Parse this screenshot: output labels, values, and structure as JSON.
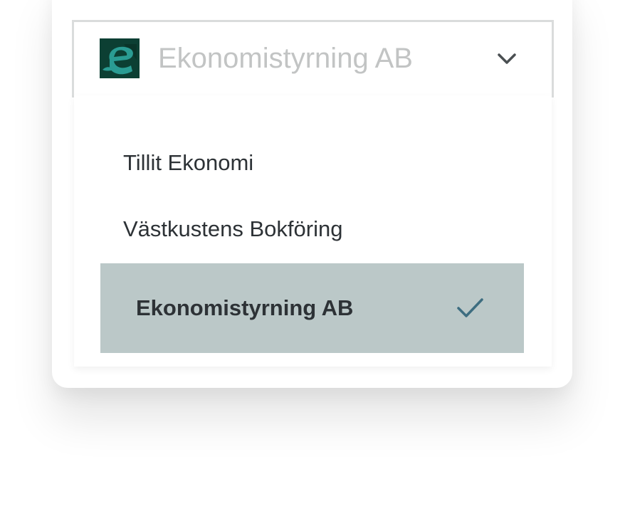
{
  "select": {
    "current_value": "Ekonomistyrning AB",
    "logo_icon": "company-logo-e",
    "chevron_icon": "chevron-down-icon"
  },
  "options": [
    {
      "label": "Tillit Ekonomi",
      "selected": false
    },
    {
      "label": "Västkustens Bokföring",
      "selected": false
    },
    {
      "label": "Ekonomistyrning AB",
      "selected": true
    }
  ],
  "colors": {
    "logo_bg": "#0c3f33",
    "logo_letter": "#2a9c93",
    "selected_bg": "#bbc8c8",
    "check": "#3d6d80",
    "placeholder_text": "#c2c4c4",
    "text": "#2d3236"
  }
}
